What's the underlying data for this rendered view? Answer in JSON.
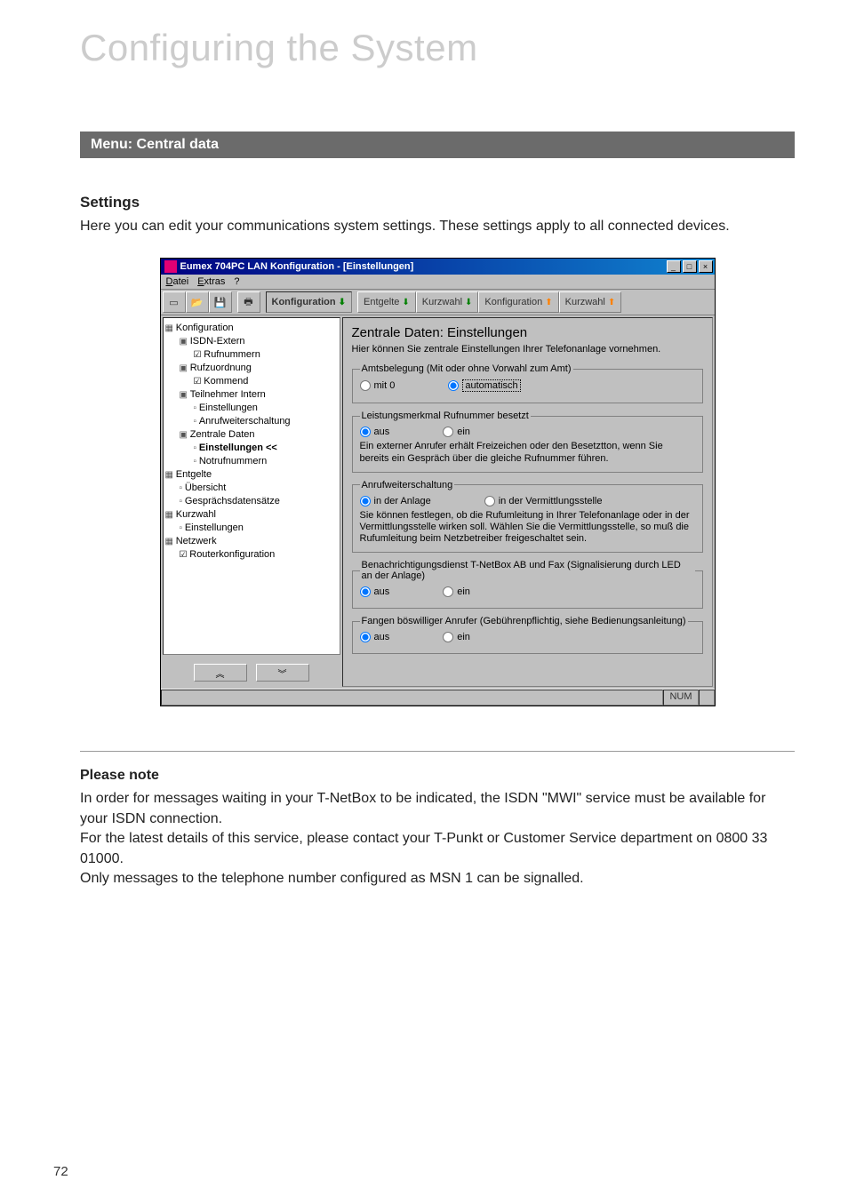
{
  "page": {
    "title": "Configuring the System",
    "menu_heading": "Menu: Central data",
    "section_heading": "Settings",
    "section_text": "Here you can edit your communications system settings. These settings apply to all connected devices.",
    "page_number": "72"
  },
  "app": {
    "title": "Eumex 704PC LAN Konfiguration - [Einstellungen]",
    "menus": {
      "datei": "Datei",
      "extras": "Extras",
      "help": "?"
    },
    "toolbar": {
      "konfiguration_down": "Konfiguration",
      "entgelte_down": "Entgelte",
      "kurzwahl_down": "Kurzwahl",
      "konfiguration_up": "Konfiguration",
      "kurzwahl_up": "Kurzwahl"
    },
    "tree": {
      "root": "Konfiguration",
      "isdn_extern": "ISDN-Extern",
      "rufnummern": "Rufnummern",
      "rufzuordnung": "Rufzuordnung",
      "kommend": "Kommend",
      "teilnehmer_intern": "Teilnehmer Intern",
      "einstellungen1": "Einstellungen",
      "anrufweiterschaltung": "Anrufweiterschaltung",
      "zentrale_daten": "Zentrale Daten",
      "einstellungen_current": "Einstellungen",
      "notrufnummern": "Notrufnummern",
      "entgelte": "Entgelte",
      "uebersicht": "Übersicht",
      "gespraechsdatensaetze": "Gesprächsdatensätze",
      "kurzwahl": "Kurzwahl",
      "einstellungen2": "Einstellungen",
      "netzwerk": "Netzwerk",
      "routerkonfiguration": "Routerkonfiguration"
    },
    "panel": {
      "title": "Zentrale Daten: Einstellungen",
      "desc": "Hier können Sie zentrale Einstellungen Ihrer Telefonanlage vornehmen.",
      "g1": {
        "legend": "Amtsbelegung (Mit oder ohne Vorwahl zum Amt)",
        "opt_a": "mit 0",
        "opt_b": "automatisch"
      },
      "g2": {
        "legend": "Leistungsmerkmal Rufnummer besetzt",
        "opt_a": "aus",
        "opt_b": "ein",
        "note": "Ein externer Anrufer erhält Freizeichen oder den Besetztton, wenn Sie bereits ein Gespräch über die gleiche Rufnummer führen."
      },
      "g3": {
        "legend": "Anrufweiterschaltung",
        "opt_a": "in der Anlage",
        "opt_b": "in der Vermittlungsstelle",
        "note": "Sie können festlegen, ob die Rufumleitung in Ihrer Telefonanlage oder in der Vermittlungsstelle wirken soll. Wählen Sie die Vermittlungsstelle, so muß die Rufumleitung beim Netzbetreiber freigeschaltet sein."
      },
      "g4": {
        "legend": "Benachrichtigungsdienst T-NetBox AB und Fax (Signalisierung durch LED an der Anlage)",
        "opt_a": "aus",
        "opt_b": "ein"
      },
      "g5": {
        "legend": "Fangen böswilliger Anrufer (Gebührenpflichtig, siehe Bedienungsanleitung)",
        "opt_a": "aus",
        "opt_b": "ein"
      }
    },
    "status": {
      "num": "NUM"
    }
  },
  "note": {
    "heading": "Please note",
    "l1": "In order for messages waiting in your T-NetBox to be indicated, the ISDN \"MWI\" service must be available for your ISDN connection.",
    "l2": "For the latest details of this service, please contact your T-Punkt or Customer Service department on 0800 33 01000.",
    "l3": "Only messages to the telephone number configured as MSN 1 can be signalled."
  }
}
